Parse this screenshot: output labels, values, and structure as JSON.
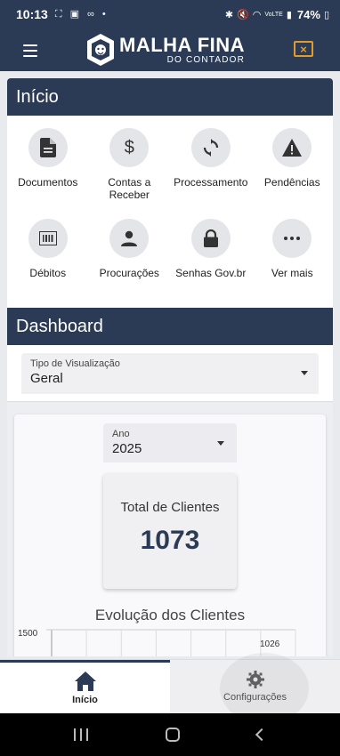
{
  "status_bar": {
    "time": "10:13",
    "battery_pct": "74%",
    "network": "VoLTE"
  },
  "app_bar": {
    "logo_main": "MALHA FINA",
    "logo_sub": "DO CONTADOR",
    "close_icon_label": "×"
  },
  "inicio": {
    "title": "Início",
    "items": [
      {
        "label": "Documentos",
        "icon": "document-icon"
      },
      {
        "label": "Contas a Receber",
        "icon": "dollar-icon"
      },
      {
        "label": "Processamento",
        "icon": "sync-icon"
      },
      {
        "label": "Pendências",
        "icon": "warning-icon"
      },
      {
        "label": "Débitos",
        "icon": "barcode-icon"
      },
      {
        "label": "Procurações",
        "icon": "person-icon"
      },
      {
        "label": "Senhas Gov.br",
        "icon": "lock-icon"
      },
      {
        "label": "Ver mais",
        "icon": "more-icon"
      }
    ]
  },
  "dashboard": {
    "title": "Dashboard",
    "view_type": {
      "label": "Tipo de Visualização",
      "value": "Geral"
    },
    "year": {
      "label": "Ano",
      "value": "2025"
    },
    "total_clients": {
      "label": "Total de Clientes",
      "value": "1073"
    }
  },
  "chart_data": {
    "type": "line",
    "title": "Evolução dos Clientes",
    "ylim_top_label": "1500",
    "visible_data_labels": [
      "1026"
    ]
  },
  "bottom_nav": {
    "home": {
      "label": "Início",
      "icon": "home-icon",
      "active": true
    },
    "settings": {
      "label": "Configurações",
      "icon": "gear-icon",
      "active": false
    }
  }
}
